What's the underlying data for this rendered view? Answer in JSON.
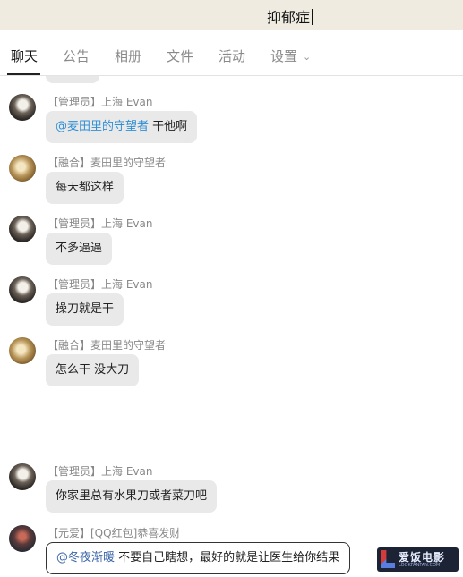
{
  "window": {
    "title": "抑郁症"
  },
  "tabs": [
    {
      "label": "聊天",
      "active": true
    },
    {
      "label": "公告"
    },
    {
      "label": "相册"
    },
    {
      "label": "文件"
    },
    {
      "label": "活动"
    },
    {
      "label": "设置",
      "has_dropdown": true
    }
  ],
  "messages": [
    {
      "avatar": "admin-avatar-girl",
      "sender": "【管理员】上海 Evan",
      "mention": "@麦田里的守望者",
      "text": " 干他啊"
    },
    {
      "avatar": "fusion-avatar",
      "sender": "【融合】麦田里的守望者",
      "text": "每天都这样"
    },
    {
      "avatar": "admin-avatar-girl",
      "sender": "【管理员】上海 Evan",
      "text": "不多逼逼"
    },
    {
      "avatar": "admin-avatar-girl",
      "sender": "【管理员】上海 Evan",
      "text": "操刀就是干"
    },
    {
      "avatar": "fusion-avatar",
      "sender": "【融合】麦田里的守望者",
      "text": "怎么干 没大刀"
    },
    {
      "avatar": "admin-avatar-girl",
      "sender": "【管理员】上海 Evan",
      "text": "你家里总有水果刀或者菜刀吧"
    },
    {
      "avatar": "yuan-avatar",
      "sender": "【元爱】[QQ红包]恭喜发财",
      "mention": "@冬夜渐暖",
      "text": " 不要自己瞎想，最好的就是让医生给你结果"
    }
  ],
  "watermark": {
    "text": "爱饭电影",
    "sub": "LOOKFANFAN.COM"
  },
  "colors": {
    "title_bar": "#efebe0",
    "mention": "#2f8fd6",
    "bubble": "#e9e9e9"
  }
}
